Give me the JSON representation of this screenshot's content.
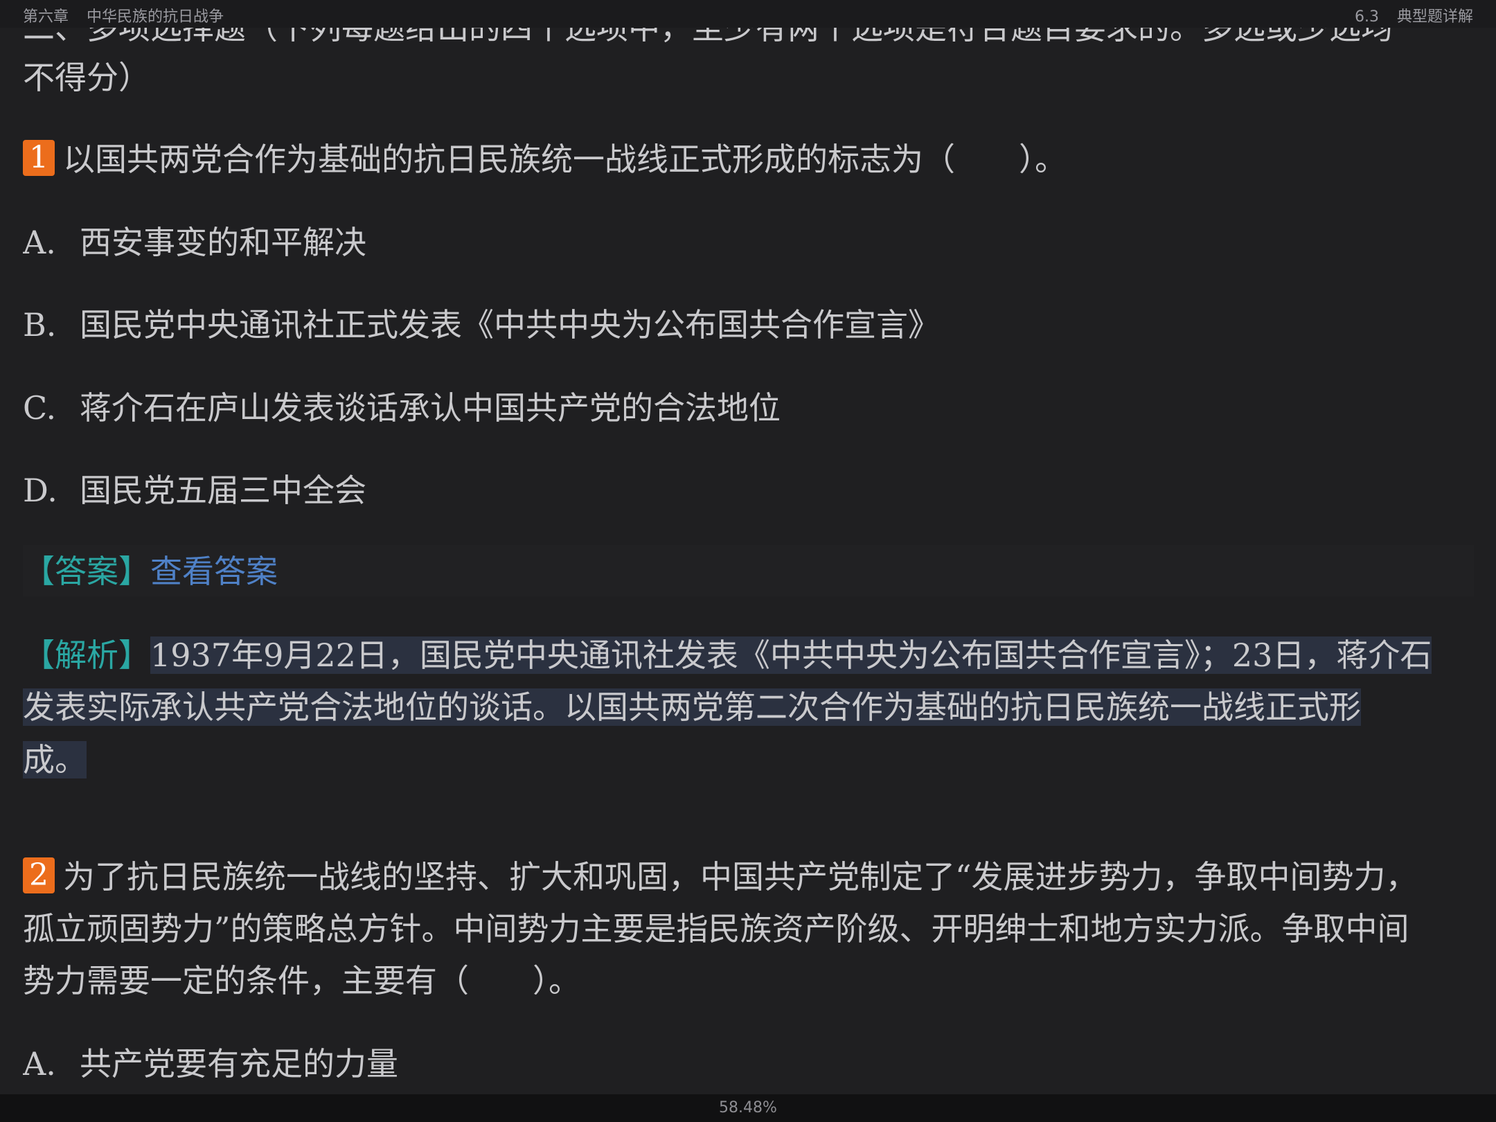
{
  "header": {
    "chapter": "第六章",
    "chapter_title": "中华民族的抗日战争",
    "section": "6.3",
    "section_title": "典型题详解"
  },
  "intro": {
    "partial_line": "二、多项选择题（下列每题给出的四个选项中，至少有两个选项是符合题目要求的。多选或少选均",
    "last_line": "不得分）"
  },
  "q1": {
    "number": "1",
    "stem": "以国共两党合作为基础的抗日民族统一战线正式形成的标志为（　　）。",
    "options": [
      {
        "letter": "A.",
        "text": "西安事变的和平解决"
      },
      {
        "letter": "B.",
        "text": "国民党中央通讯社正式发表《中共中央为公布国共合作宣言》"
      },
      {
        "letter": "C.",
        "text": "蒋介石在庐山发表谈话承认中国共产党的合法地位"
      },
      {
        "letter": "D.",
        "text": "国民党五届三中全会"
      }
    ],
    "answer_tag": "【答案】",
    "answer_link": "查看答案",
    "analysis_tag": "【解析】",
    "analysis_lines": [
      "1937年9月22日，国民党中央通讯社发表《中共中央为公布国共合作宣言》；23日，蒋介石",
      "发表实际承认共产党合法地位的谈话。以国共两党第二次合作为基础的抗日民族统一战线正式形",
      "成。"
    ]
  },
  "q2": {
    "number": "2",
    "stem_lines": [
      "为了抗日民族统一战线的坚持、扩大和巩固，中国共产党制定了“发展进步势力，争取中间势力，",
      "孤立顽固势力”的策略总方针。中间势力主要是指民族资产阶级、开明绅士和地方实力派。争取中间",
      "势力需要一定的条件，主要有（　　）。"
    ],
    "options": [
      {
        "letter": "A.",
        "text": "共产党要有充足的力量"
      }
    ]
  },
  "footer": {
    "progress": "58.48%"
  },
  "colors": {
    "background": "#1f1f21",
    "badge": "#ec6d1c",
    "tag": "#2aa7a3",
    "link": "#4f81c7",
    "highlight": "#2b3140"
  }
}
